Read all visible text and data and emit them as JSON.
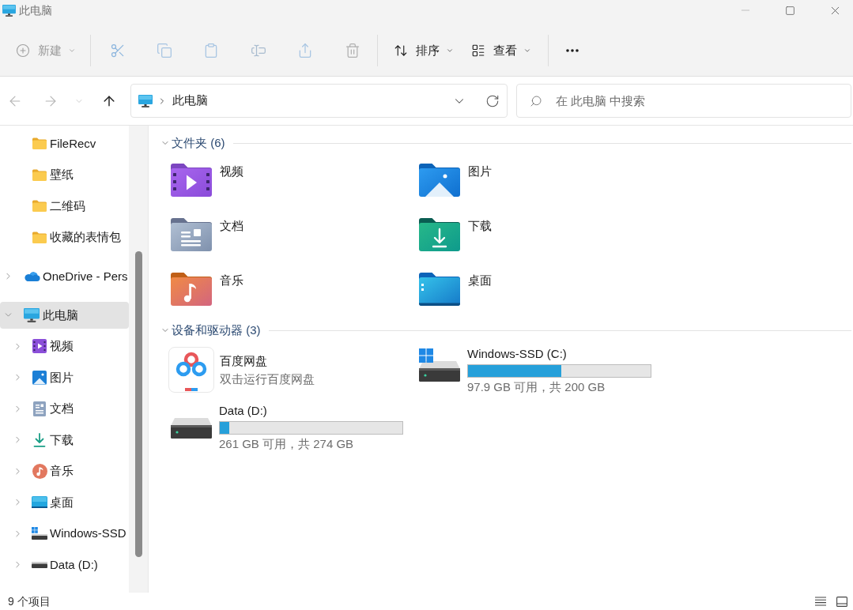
{
  "window": {
    "title": "此电脑"
  },
  "toolbar": {
    "groups": [
      [
        {
          "kind": "new",
          "label": "新建",
          "disabled": true
        }
      ],
      [
        {
          "kind": "cut",
          "disabled": true
        },
        {
          "kind": "copy",
          "disabled": true
        },
        {
          "kind": "paste",
          "disabled": true
        },
        {
          "kind": "rename",
          "disabled": true
        },
        {
          "kind": "share",
          "disabled": true
        },
        {
          "kind": "delete",
          "disabled": true
        }
      ],
      [
        {
          "kind": "sort",
          "label": "排序",
          "disabled": false
        },
        {
          "kind": "view",
          "label": "查看",
          "disabled": false
        }
      ],
      [
        {
          "kind": "more",
          "disabled": false
        }
      ]
    ]
  },
  "navigation": {
    "buttons": [
      {
        "kind": "back",
        "disabled": true
      },
      {
        "kind": "forward",
        "disabled": true
      },
      {
        "kind": "recent",
        "disabled": true
      },
      {
        "kind": "up",
        "disabled": false
      }
    ],
    "path": [
      "此电脑"
    ],
    "search": {
      "placeholder": "在 此电脑 中搜索"
    }
  },
  "sidebar": {
    "pinned": [
      {
        "label": "FileRecv",
        "selected": false
      },
      {
        "label": "壁纸",
        "selected": false
      },
      {
        "label": "二维码",
        "selected": false
      },
      {
        "label": "收藏的表情包",
        "selected": false
      }
    ],
    "tree": [
      {
        "kind": "onedrive",
        "label": "OneDrive - Pers",
        "expanded": false,
        "selected": false
      },
      {
        "kind": "pc",
        "label": "此电脑",
        "expanded": true,
        "selected": true,
        "children": [
          {
            "kind": "videos",
            "label": "视频",
            "expanded": false,
            "selected": false
          },
          {
            "kind": "pictures",
            "label": "图片",
            "expanded": false,
            "selected": false
          },
          {
            "kind": "documents",
            "label": "文档",
            "expanded": false,
            "selected": false
          },
          {
            "kind": "downloads",
            "label": "下载",
            "expanded": false,
            "selected": false
          },
          {
            "kind": "music",
            "label": "音乐",
            "expanded": false,
            "selected": false
          },
          {
            "kind": "desktop",
            "label": "桌面",
            "expanded": false,
            "selected": false
          },
          {
            "kind": "system-drive",
            "label": "Windows-SSD",
            "expanded": false,
            "selected": false
          },
          {
            "kind": "drive",
            "label": "Data (D:)",
            "expanded": false,
            "selected": false
          }
        ]
      }
    ]
  },
  "main": {
    "groups": [
      {
        "title": "文件夹 (6)",
        "expanded": true,
        "items": [
          {
            "kind": "videos",
            "label": "视频"
          },
          {
            "kind": "pictures",
            "label": "图片"
          },
          {
            "kind": "documents",
            "label": "文档"
          },
          {
            "kind": "downloads",
            "label": "下载"
          },
          {
            "kind": "music",
            "label": "音乐"
          },
          {
            "kind": "desktop",
            "label": "桌面"
          }
        ]
      },
      {
        "title": "设备和驱动器 (3)",
        "expanded": true,
        "items": [
          {
            "kind": "app",
            "label": "百度网盘",
            "subtitle": "双击运行百度网盘"
          },
          {
            "kind": "system-drive",
            "label": "Windows-SSD (C:)",
            "level": 0.51,
            "reading": "97.9 GB 可用，共 200 GB"
          },
          {
            "kind": "drive",
            "label": "Data (D:)",
            "level": 0.05,
            "reading": "261 GB 可用，共 274 GB"
          }
        ]
      }
    ]
  },
  "status_bar": {
    "item_count": "9 个项目",
    "views": [
      {
        "kind": "details"
      },
      {
        "kind": "tiles"
      }
    ]
  }
}
